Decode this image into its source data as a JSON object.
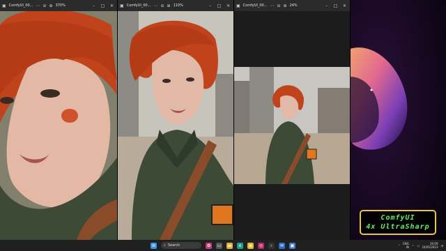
{
  "windows": [
    {
      "title": "ComfyUI_00...",
      "zoom": "370%"
    },
    {
      "title": "ComfyUI_00...",
      "zoom": "110%"
    },
    {
      "title": "ComfyUI_00...",
      "zoom": "24%"
    }
  ],
  "badge": {
    "line1": "ComfyUI",
    "line2": "4x UltraSharp"
  },
  "taskbar": {
    "search_placeholder": "Search",
    "lang_top": "ENG",
    "lang_bottom": "IN",
    "time": "20:09",
    "date": "24/05/2023"
  },
  "colors": {
    "hair": "#c1431c",
    "jacket": "#3d4a36",
    "badge_border": "#e8c64a",
    "badge_text": "#5ff06a"
  }
}
